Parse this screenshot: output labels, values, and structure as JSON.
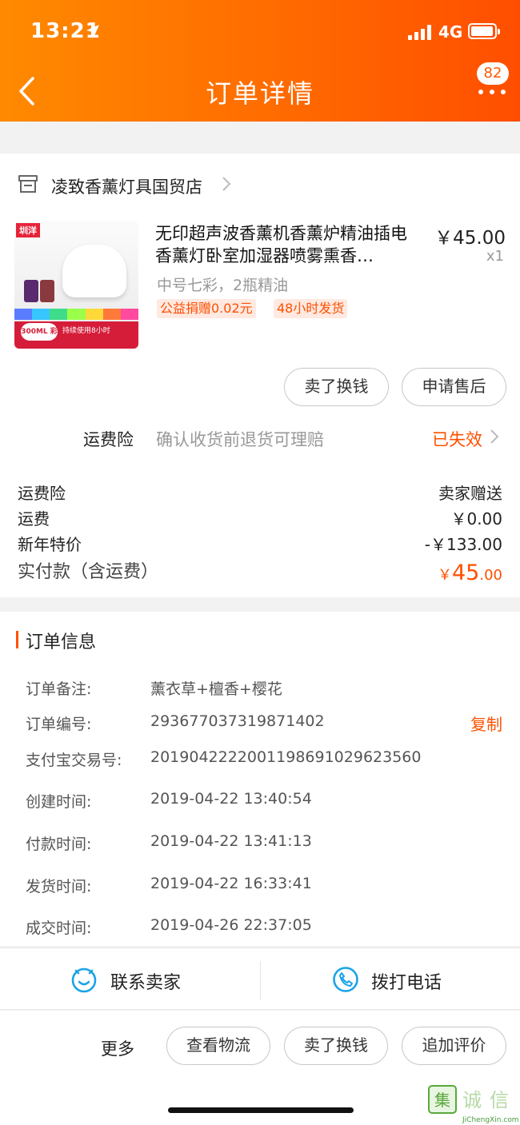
{
  "status": {
    "time": "13:21",
    "network": "4G"
  },
  "header": {
    "title": "订单详情",
    "badge": "82"
  },
  "store": {
    "name": "凌致香薰灯具国贸店"
  },
  "product": {
    "image_brand": "圳洋",
    "image_badge": "300ML 彩灯",
    "image_note": "持续使用8小时",
    "title": "无印超声波香薰机香薰炉精油插电香薰灯卧室加湿器喷雾熏香…",
    "price": "￥45.00",
    "qty": "x1",
    "sku": "中号七彩，2瓶精油",
    "tags": [
      "公益捐赠0.02元",
      "48小时发货"
    ]
  },
  "actions": {
    "sell": "卖了换钱",
    "after_sale": "申请售后"
  },
  "insurance": {
    "label": "运费险",
    "desc": "确认收货前退货可理赔",
    "status": "已失效"
  },
  "fees": [
    {
      "label": "运费险",
      "value": "卖家赠送"
    },
    {
      "label": "运费",
      "value": "￥0.00"
    },
    {
      "label": "新年特价",
      "value": "-￥133.00"
    }
  ],
  "total": {
    "label": "实付款（含运费）",
    "currency": "￥",
    "int": "45",
    "dec": ".00"
  },
  "order_info": {
    "title": "订单信息",
    "rows": [
      {
        "label": "订单备注:",
        "value": "薰衣草+檀香+樱花"
      },
      {
        "label": "订单编号:",
        "value": "293677037319871402"
      },
      {
        "label": "支付宝交易号:",
        "value": "2019042222001198691029623560"
      },
      {
        "label": "创建时间:",
        "value": "2019-04-22 13:40:54"
      },
      {
        "label": "付款时间:",
        "value": "2019-04-22 13:41:13"
      },
      {
        "label": "发货时间:",
        "value": "2019-04-22 16:33:41"
      },
      {
        "label": "成交时间:",
        "value": "2019-04-26 22:37:05"
      }
    ],
    "copy": "复制"
  },
  "contact": {
    "seller": "联系卖家",
    "call": "拨打电话"
  },
  "bottom": {
    "more": "更多",
    "logistics": "查看物流",
    "sell": "卖了换钱",
    "review": "追加评价"
  },
  "watermark": {
    "text": "JiChengXin.com"
  },
  "colors": {
    "accent": "#ff5000",
    "header_start": "#ff8a00",
    "header_end": "#ff4e00",
    "icon_blue": "#1aa3e8"
  }
}
